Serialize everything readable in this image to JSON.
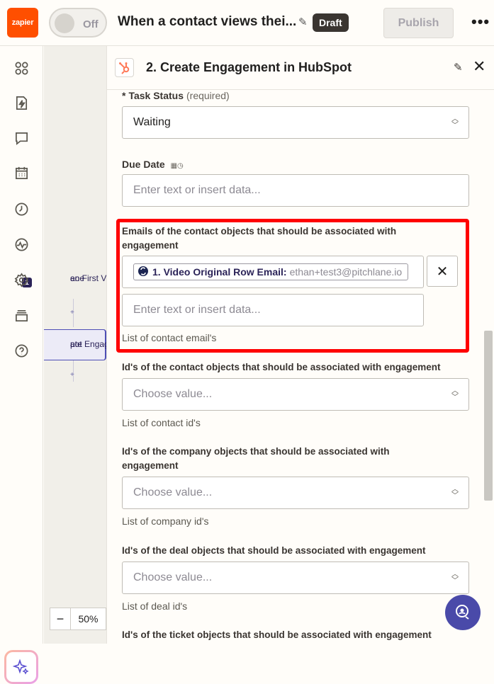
{
  "topbar": {
    "logo": "zapier",
    "toggle_label": "Off",
    "zap_title": "When a contact views thei...",
    "status": "Draft",
    "publish_label": "Publish",
    "more_icon": "more-dots-icon"
  },
  "sidebar": {
    "activity_badge": "1",
    "icons": [
      "apps-icon",
      "zap-file-icon",
      "comment-icon",
      "calendar-icon",
      "history-icon",
      "activity-icon",
      "settings-icon",
      "layers-icon",
      "help-icon"
    ]
  },
  "canvas": {
    "node1_label": "eo First Viewed i",
    "node1_sub": "ane",
    "node2_label": "ate Engagemen",
    "node2_sub": "pot",
    "zoom_minus": "−",
    "zoom_level": "50%"
  },
  "panel": {
    "title": "2. Create Engagement in HubSpot",
    "fields": {
      "task_status": {
        "star": "*",
        "label": "Task Status",
        "required": "(required)",
        "value": "Waiting"
      },
      "due_date": {
        "label": "Due Date",
        "placeholder": "Enter text or insert data..."
      },
      "emails": {
        "label_line1": "Emails of the contact objects that should be associated with",
        "label_line2": "engagement",
        "chip_label": "1. Video Original Row Email:",
        "chip_value": "ethan+test3@pitchlane.io",
        "remove": "✕",
        "placeholder": "Enter text or insert data...",
        "help": "List of contact email's"
      },
      "contact_ids": {
        "label": "Id's of the contact objects that should be associated with engagement",
        "placeholder": "Choose value...",
        "help": "List of contact id's"
      },
      "company_ids": {
        "label_line1": "Id's of the company objects that should be associated with",
        "label_line2": "engagement",
        "placeholder": "Choose value...",
        "help": "List of company id's"
      },
      "deal_ids": {
        "label": "Id's of the deal objects that should be associated with engagement",
        "placeholder": "Choose value...",
        "help": "List of deal id's"
      },
      "ticket_ids": {
        "label": "Id's of the ticket objects that should be associated with engagement"
      }
    }
  },
  "colors": {
    "brand": "#ff4f00",
    "highlight": "#ff0000",
    "accent": "#4a4aa9"
  }
}
